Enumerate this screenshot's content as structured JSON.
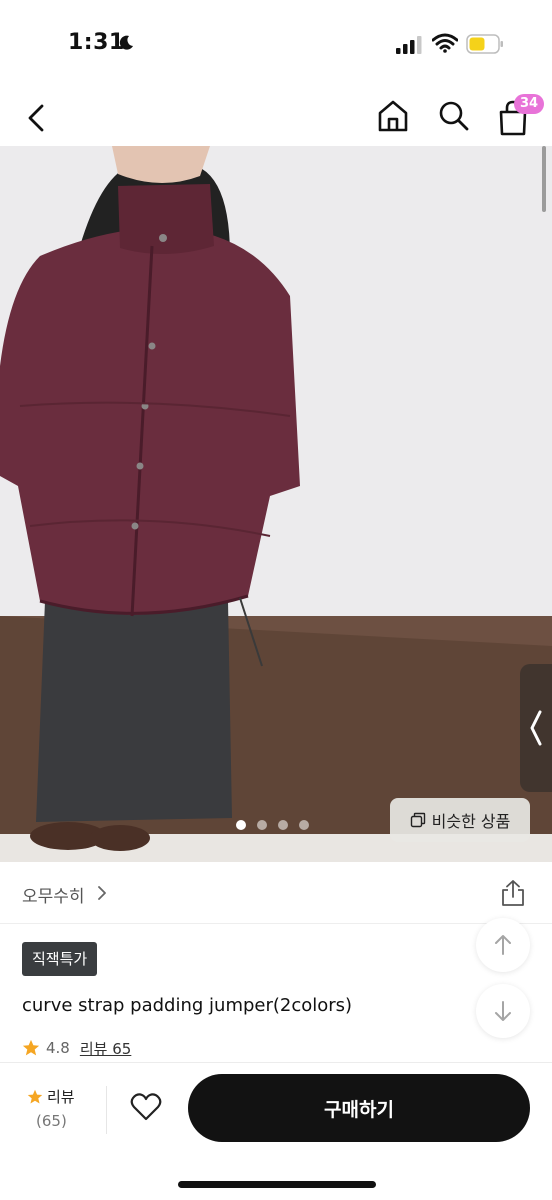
{
  "status_bar": {
    "time": "1:31",
    "icons": [
      "moon-icon",
      "signal-icon",
      "wifi-icon",
      "battery-icon"
    ],
    "battery_color": "#f5d21a"
  },
  "nav": {
    "icons": [
      "back-icon",
      "home-icon",
      "search-icon",
      "cart-icon"
    ],
    "cart_count": "34",
    "badge_color": "#e873d8"
  },
  "gallery": {
    "page_count": 4,
    "current_page": 1,
    "similar_label": "비슷한 상품"
  },
  "shop": {
    "name": "오무수히"
  },
  "product": {
    "badge": "직잭특가",
    "title": "curve strap padding jumper(2colors)",
    "rating": "4.8",
    "review_link": "리뷰 65"
  },
  "bottom_bar": {
    "review_label": "리뷰",
    "review_count": "(65)",
    "buy_label": "구매하기"
  },
  "colors": {
    "star": "#f5a623",
    "jacket": "#6a2d3e",
    "buy_button": "#121212"
  }
}
